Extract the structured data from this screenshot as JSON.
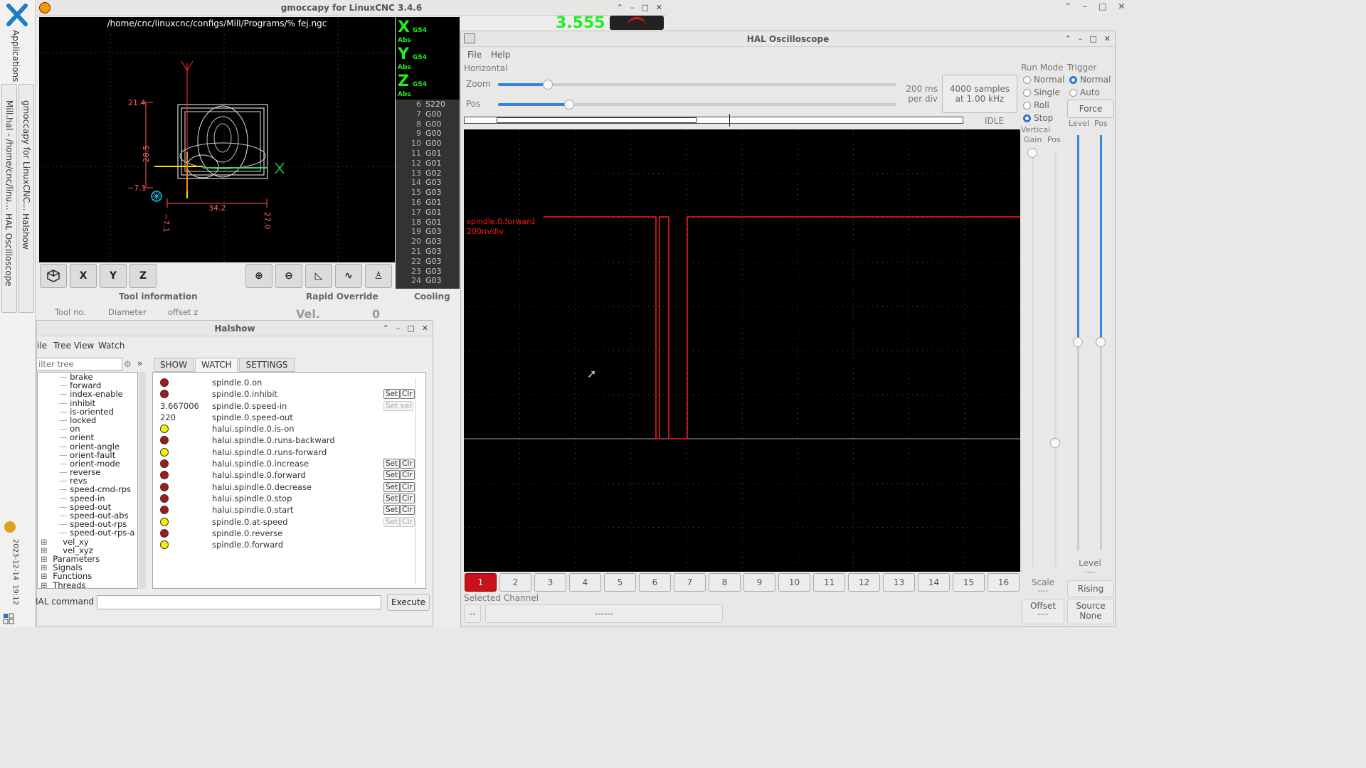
{
  "taskbar": {
    "applications": "Applications",
    "task_milhal": "Mill.hal - /home/cnc/linu...",
    "task_gmoccapy": "gmoccapy for LinuxCNC...",
    "task_oscilloscope": "HAL Oscilloscope",
    "task_halshow": "Halshow",
    "date": "2023-12-14",
    "time": "19:12"
  },
  "gmoccapy": {
    "title": "gmoccapy for LinuxCNC 3.4.6",
    "file_path": "/home/cnc/linuxcnc/configs/Mill/Programs/% fej.ngc",
    "preview": {
      "dim_214": "21.4",
      "dim_285": "28.5",
      "dim_m71": "−7.1",
      "dim_m71b": "−7.1",
      "dim_342": "34.2",
      "dim_270": "27.0",
      "axis_x": "X",
      "axis_y": "Y"
    },
    "dro": {
      "x": "X",
      "y": "Y",
      "z": "Z",
      "g54": "G54",
      "abs": "Abs",
      "value": "3.555"
    },
    "gcode": [
      {
        "n": "6",
        "c": "S220"
      },
      {
        "n": "7",
        "c": "G00"
      },
      {
        "n": "8",
        "c": "G00"
      },
      {
        "n": "9",
        "c": "G00"
      },
      {
        "n": "10",
        "c": "G00"
      },
      {
        "n": "11",
        "c": "G01"
      },
      {
        "n": "12",
        "c": "G01"
      },
      {
        "n": "13",
        "c": "G02"
      },
      {
        "n": "14",
        "c": "G03"
      },
      {
        "n": "15",
        "c": "G03"
      },
      {
        "n": "16",
        "c": "G01"
      },
      {
        "n": "17",
        "c": "G01"
      },
      {
        "n": "18",
        "c": "G01"
      },
      {
        "n": "19",
        "c": "G03"
      },
      {
        "n": "20",
        "c": "G03"
      },
      {
        "n": "21",
        "c": "G03"
      },
      {
        "n": "22",
        "c": "G03"
      },
      {
        "n": "23",
        "c": "G03"
      },
      {
        "n": "24",
        "c": "G03"
      }
    ],
    "toolbar": {
      "x": "X",
      "y": "Y",
      "z": "Z"
    },
    "tool_info": "Tool information",
    "tool_no": "Tool no.",
    "diameter": "Diameter",
    "offset_z": "offset z",
    "rapid_override": "Rapid Override",
    "vel": "Vel.",
    "vel_value": "0",
    "cooling": "Cooling"
  },
  "halshow": {
    "title": "Halshow",
    "menu": {
      "file": "ile",
      "tree_view": "Tree View",
      "watch": "Watch"
    },
    "filter_placeholder": "ilter tree",
    "tabs": {
      "show": "SHOW",
      "watch": "WATCH",
      "settings": "SETTINGS"
    },
    "tree": [
      "brake",
      "forward",
      "index-enable",
      "inhibit",
      "is-oriented",
      "locked",
      "on",
      "orient",
      "orient-angle",
      "orient-fault",
      "orient-mode",
      "reverse",
      "revs",
      "speed-cmd-rps",
      "speed-in",
      "speed-out",
      "speed-out-abs",
      "speed-out-rps",
      "speed-out-rps-a"
    ],
    "tree_nodes": [
      "vel_xy",
      "vel_xyz"
    ],
    "tree_top": [
      "Parameters",
      "Signals",
      "Functions",
      "Threads"
    ],
    "watch_rows": [
      {
        "type": "led-red",
        "name": "spindle.0.on",
        "buttons": ""
      },
      {
        "type": "led-red",
        "name": "spindle.0.inhibit",
        "buttons": "setclr"
      },
      {
        "type": "val",
        "value": "3.667006",
        "name": "spindle.0.speed-in",
        "buttons": "setval"
      },
      {
        "type": "val",
        "value": "220",
        "name": "spindle.0.speed-out",
        "buttons": ""
      },
      {
        "type": "led-yel",
        "name": "halui.spindle.0.is-on",
        "buttons": ""
      },
      {
        "type": "led-red",
        "name": "halui.spindle.0.runs-backward",
        "buttons": ""
      },
      {
        "type": "led-yel",
        "name": "halui.spindle.0.runs-forward",
        "buttons": ""
      },
      {
        "type": "led-red",
        "name": "halui.spindle.0.increase",
        "buttons": "setclr"
      },
      {
        "type": "led-red",
        "name": "halui.spindle.0.forward",
        "buttons": "setclr"
      },
      {
        "type": "led-red",
        "name": "halui.spindle.0.decrease",
        "buttons": "setclr"
      },
      {
        "type": "led-red",
        "name": "halui.spindle.0.stop",
        "buttons": "setclr"
      },
      {
        "type": "led-red",
        "name": "halui.spindle.0.start",
        "buttons": "setclr"
      },
      {
        "type": "led-yel",
        "name": "spindle.0.at-speed",
        "buttons": "setclr-dis"
      },
      {
        "type": "led-red",
        "name": "spindle.0.reverse",
        "buttons": ""
      },
      {
        "type": "led-yel",
        "name": "spindle.0.forward",
        "buttons": ""
      }
    ],
    "set": "Set",
    "clr": "Clr",
    "set_val": "Set val",
    "hal_command_label": "IAL command :",
    "execute": "Execute"
  },
  "scope": {
    "title": "HAL Oscilloscope",
    "menu": {
      "file": "File",
      "help": "Help"
    },
    "horizontal": "Horizontal",
    "zoom": "Zoom",
    "pos": "Pos",
    "ms_per_div": "200 ms",
    "per_div": "per div",
    "samples": "4000 samples",
    "rate": "at 1.00 kHz",
    "state": "IDLE",
    "run_mode": "Run Mode",
    "run_modes": [
      "Normal",
      "Single",
      "Roll",
      "Stop"
    ],
    "run_mode_selected": "Stop",
    "trigger": "Trigger",
    "trigger_modes": [
      "Normal",
      "Auto"
    ],
    "trigger_selected": "Normal",
    "force": "Force",
    "level": "Level",
    "trig_pos": "Pos",
    "vertical": "Vertical",
    "gain": "Gain",
    "vpos": "Pos",
    "trace_label": "spindle.0.forward",
    "trace_scale": "200m/div",
    "channels": [
      "1",
      "2",
      "3",
      "4",
      "5",
      "6",
      "7",
      "8",
      "9",
      "10",
      "11",
      "12",
      "13",
      "14",
      "15",
      "16"
    ],
    "selected_channel_label": "Selected Channel",
    "selected_channel_num": "--",
    "selected_channel_name": "------",
    "scale": "Scale",
    "scale_value": "----",
    "offset": "Offset",
    "offset_value": "----",
    "level_bottom": "Level",
    "level_bottom_value": "----",
    "rising": "Rising",
    "source": "Source",
    "source_value": "None",
    "trace_color": "#ff1a1a"
  }
}
